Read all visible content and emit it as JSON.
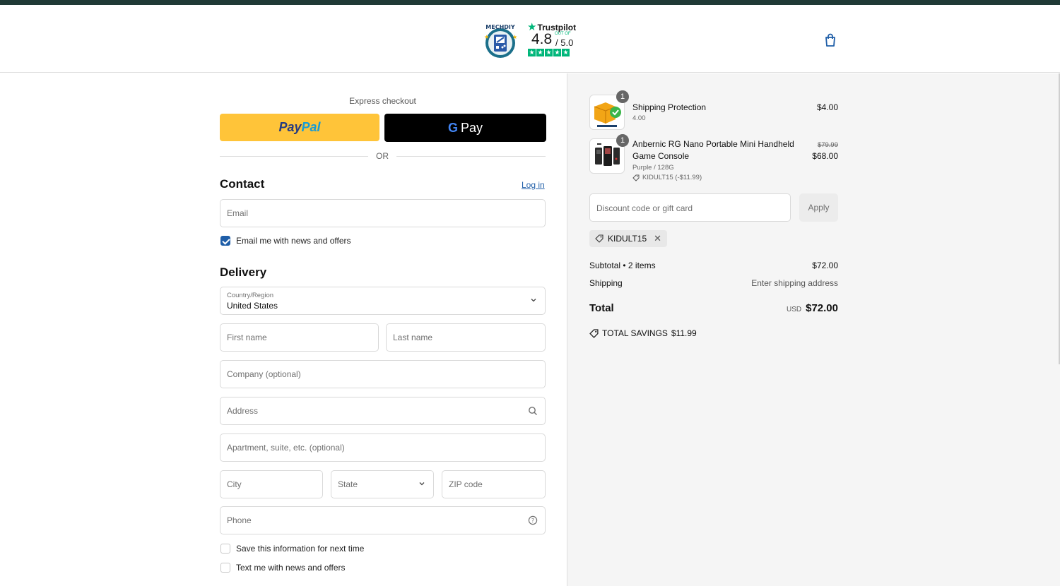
{
  "header": {
    "logo_text": "MECHDIY",
    "trustpilot": {
      "brand": "Trustpilot",
      "score": "4.8",
      "out_of_label": "OUT OF",
      "out_of": "/ 5.0",
      "stars": 5
    },
    "cart_icon": "shopping-bag-icon"
  },
  "express": {
    "label": "Express checkout",
    "paypal": {
      "pay": "Pay",
      "pal": "Pal"
    },
    "gpay": {
      "g": "G",
      "pay": "Pay"
    },
    "or": "OR"
  },
  "contact": {
    "title": "Contact",
    "login": "Log in",
    "email_placeholder": "Email",
    "news_checkbox": {
      "label": "Email me with news and offers",
      "checked": true
    }
  },
  "delivery": {
    "title": "Delivery",
    "country": {
      "label": "Country/Region",
      "value": "United States"
    },
    "first_name": "First name",
    "last_name": "Last name",
    "company": "Company (optional)",
    "address": "Address",
    "apartment": "Apartment, suite, etc. (optional)",
    "city": "City",
    "state": "State",
    "zip": "ZIP code",
    "phone": "Phone",
    "save_info": {
      "label": "Save this information for next time",
      "checked": false
    },
    "text_me": {
      "label": "Text me with news and offers",
      "checked": false
    }
  },
  "summary": {
    "items": [
      {
        "qty": "1",
        "name": "Shipping Protection",
        "sub": "4.00",
        "price": "$4.00"
      },
      {
        "qty": "1",
        "name": "Anbernic RG Nano Portable Mini Handheld Game Console",
        "variant": "Purple / 128G",
        "discount": "KIDULT15 (-$11.99)",
        "old_price": "$79.99",
        "price": "$68.00"
      }
    ],
    "discount_placeholder": "Discount code or gift card",
    "apply": "Apply",
    "applied_code": "KIDULT15",
    "subtotal_label": "Subtotal • 2 items",
    "subtotal_value": "$72.00",
    "shipping_label": "Shipping",
    "shipping_value": "Enter shipping address",
    "total_label": "Total",
    "total_currency": "USD",
    "total_value": "$72.00",
    "savings_label": "TOTAL SAVINGS",
    "savings_value": "$11.99"
  },
  "colors": {
    "topbar": "#203a36",
    "paypal_bg": "#ffc439",
    "gpay_bg": "#000000",
    "link": "#1f5ea8",
    "trustpilot_green": "#00b67a"
  }
}
